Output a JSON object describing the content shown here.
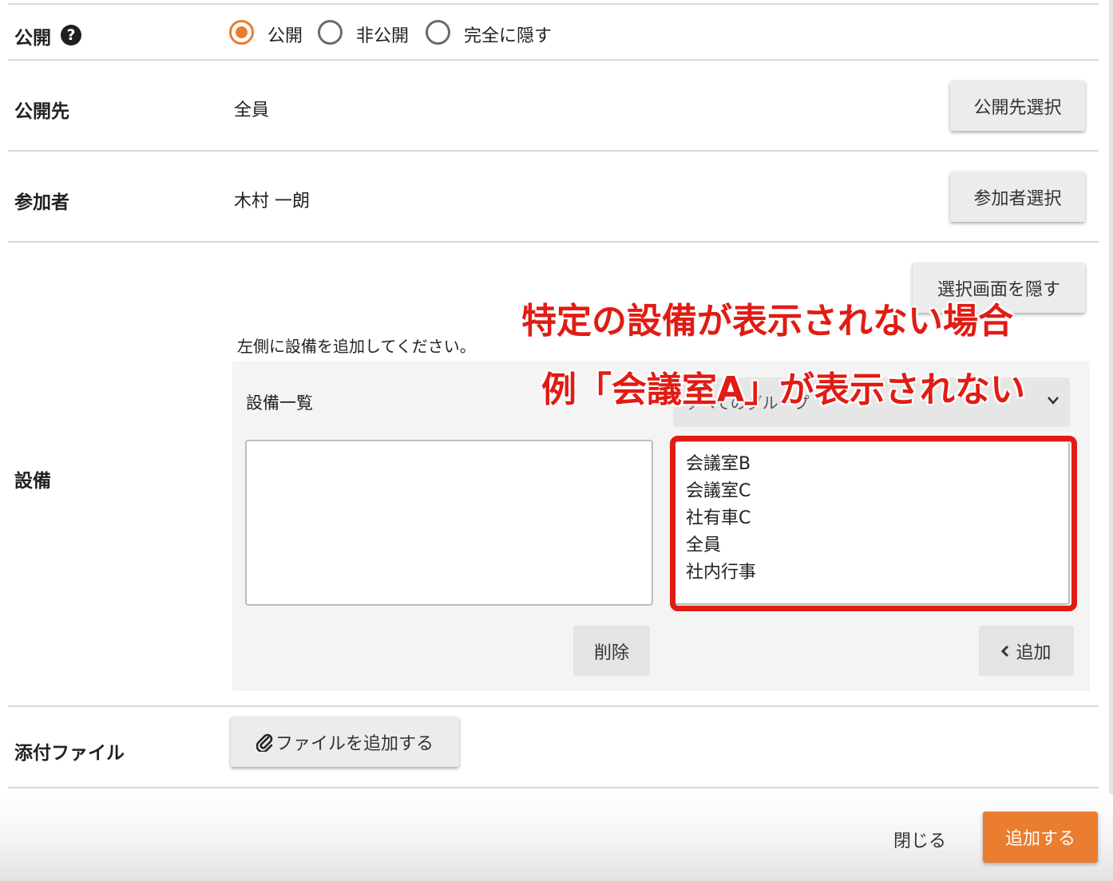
{
  "visibility": {
    "label": "公開",
    "help_icon": "?",
    "options": [
      {
        "label": "公開",
        "selected": true
      },
      {
        "label": "非公開",
        "selected": false
      },
      {
        "label": "完全に隠す",
        "selected": false
      }
    ]
  },
  "audience": {
    "label": "公開先",
    "value": "全員",
    "button": "公開先選択"
  },
  "participants": {
    "label": "参加者",
    "value": "木村 一朗",
    "button": "参加者選択"
  },
  "equipment": {
    "label": "設備",
    "hide_button": "選択画面を隠す",
    "hint": "左側に設備を追加してください。",
    "list_title": "設備一覧",
    "group_select": "すべてのグループ",
    "selected_items": [],
    "available_items": [
      "会議室B",
      "会議室C",
      "社有車C",
      "全員",
      "社内行事"
    ],
    "delete_button": "削除",
    "add_button": "追加"
  },
  "attachment": {
    "label": "添付ファイル",
    "button": "ファイルを追加する"
  },
  "footer": {
    "close_label": "閉じる",
    "submit_label": "追加する"
  },
  "annotation": {
    "line1": "特定の設備が表示されない場合",
    "line2": "例「会議室A」が表示されない",
    "color": "#e01c14"
  },
  "colors": {
    "accent": "#ea7d30",
    "highlight": "#e01c14"
  },
  "icons": {
    "help": "question-circle-icon",
    "paperclip": "paperclip-icon",
    "chevron_left": "chevron-left-icon",
    "chevron_down": "chevron-down-icon"
  }
}
